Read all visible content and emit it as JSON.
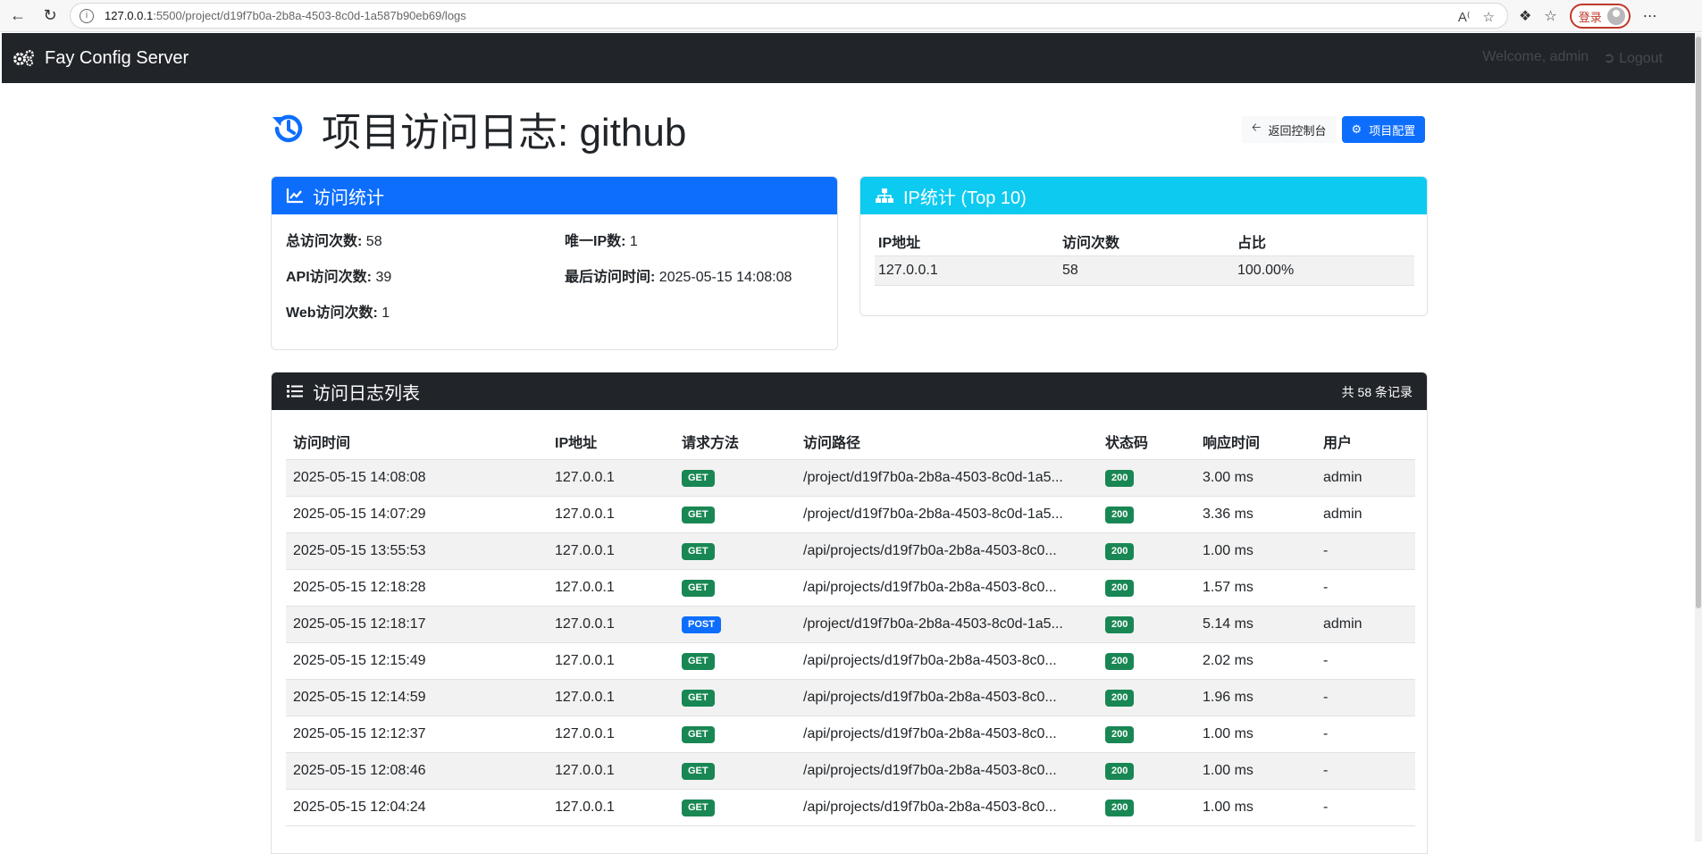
{
  "browser": {
    "url_host": "127.0.0.1",
    "url_path": ":5500/project/d19f7b0a-2b8a-4503-8c0d-1a587b90eb69/logs",
    "login_label": "登录"
  },
  "navbar": {
    "brand": "Fay Config Server",
    "welcome": "Welcome, admin",
    "logout": "Logout"
  },
  "header": {
    "title": "项目访问日志: github",
    "back_label": "返回控制台",
    "config_label": "项目配置"
  },
  "stats": {
    "title": "访问统计",
    "total_label": "总访问次数:",
    "total_value": "58",
    "unique_ip_label": "唯一IP数:",
    "unique_ip_value": "1",
    "api_label": "API访问次数:",
    "api_value": "39",
    "last_label": "最后访问时间:",
    "last_value": "2025-05-15 14:08:08",
    "web_label": "Web访问次数:",
    "web_value": "1"
  },
  "ip_stats": {
    "title": "IP统计 (Top 10)",
    "headers": [
      "IP地址",
      "访问次数",
      "占比"
    ],
    "rows": [
      [
        "127.0.0.1",
        "58",
        "100.00%"
      ]
    ]
  },
  "logs": {
    "title": "访问日志列表",
    "count": "共 58 条记录",
    "headers": [
      "访问时间",
      "IP地址",
      "请求方法",
      "访问路径",
      "状态码",
      "响应时间",
      "用户"
    ],
    "rows": [
      [
        "2025-05-15 14:08:08",
        "127.0.0.1",
        "GET",
        "/project/d19f7b0a-2b8a-4503-8c0d-1a5...",
        "200",
        "3.00 ms",
        "admin"
      ],
      [
        "2025-05-15 14:07:29",
        "127.0.0.1",
        "GET",
        "/project/d19f7b0a-2b8a-4503-8c0d-1a5...",
        "200",
        "3.36 ms",
        "admin"
      ],
      [
        "2025-05-15 13:55:53",
        "127.0.0.1",
        "GET",
        "/api/projects/d19f7b0a-2b8a-4503-8c0...",
        "200",
        "1.00 ms",
        "-"
      ],
      [
        "2025-05-15 12:18:28",
        "127.0.0.1",
        "GET",
        "/api/projects/d19f7b0a-2b8a-4503-8c0...",
        "200",
        "1.57 ms",
        "-"
      ],
      [
        "2025-05-15 12:18:17",
        "127.0.0.1",
        "POST",
        "/project/d19f7b0a-2b8a-4503-8c0d-1a5...",
        "200",
        "5.14 ms",
        "admin"
      ],
      [
        "2025-05-15 12:15:49",
        "127.0.0.1",
        "GET",
        "/api/projects/d19f7b0a-2b8a-4503-8c0...",
        "200",
        "2.02 ms",
        "-"
      ],
      [
        "2025-05-15 12:14:59",
        "127.0.0.1",
        "GET",
        "/api/projects/d19f7b0a-2b8a-4503-8c0...",
        "200",
        "1.96 ms",
        "-"
      ],
      [
        "2025-05-15 12:12:37",
        "127.0.0.1",
        "GET",
        "/api/projects/d19f7b0a-2b8a-4503-8c0...",
        "200",
        "1.00 ms",
        "-"
      ],
      [
        "2025-05-15 12:08:46",
        "127.0.0.1",
        "GET",
        "/api/projects/d19f7b0a-2b8a-4503-8c0...",
        "200",
        "1.00 ms",
        "-"
      ],
      [
        "2025-05-15 12:04:24",
        "127.0.0.1",
        "GET",
        "/api/projects/d19f7b0a-2b8a-4503-8c0...",
        "200",
        "1.00 ms",
        "-"
      ]
    ]
  },
  "colors": {
    "primary": "#0d6efd",
    "info": "#0dcaf0",
    "dark": "#212529",
    "success": "#198754"
  }
}
